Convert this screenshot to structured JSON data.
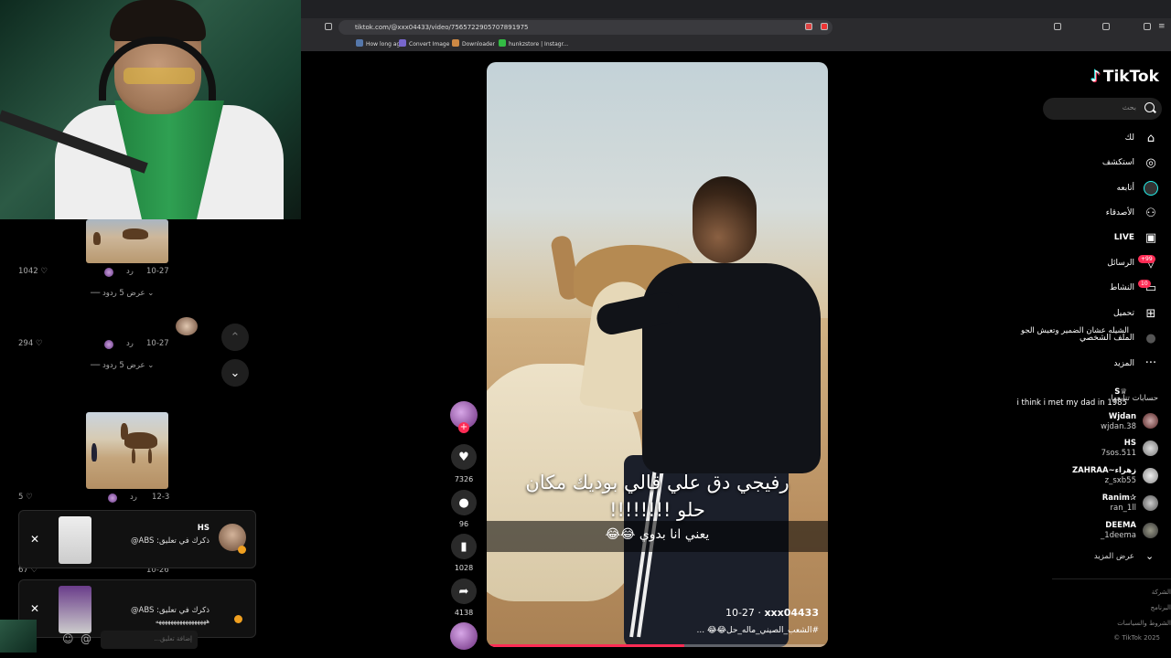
{
  "browser": {
    "url": "tiktok.com/@xxx04433/video/7565722905707891975",
    "bookmarks": [
      "How long ago",
      "Convert Image",
      "Downloader",
      "hunkzstore | Instagr..."
    ]
  },
  "comments": [
    {
      "date": "10-27",
      "reply": "رد",
      "likes": "1042",
      "view_replies": "عرض 5 ردود"
    },
    {
      "text": "الشيله عشان الضمير وتعيش الجو",
      "date": "10-27",
      "reply": "رد",
      "likes": "294",
      "view_replies": "عرض 5 ردود"
    },
    {
      "author": "S",
      "text": "i think i met my dad in 1985",
      "date": "12-3",
      "reply": "رد",
      "likes": "5"
    }
  ],
  "notifications": [
    {
      "title": "HS",
      "subtitle": "ذكرك في تعليق: ABS@"
    },
    {
      "subtitle": "ذكرك في تعليق: ABS@",
      "subtitle2": "هههههههههههههههههه"
    }
  ],
  "hidden_row": {
    "likes": "67",
    "date": "10-26"
  },
  "comment_input_placeholder": "إضافة تعليق...",
  "video": {
    "subtitle_line1": "رفيجي دق علي قالي بوديك مكان",
    "subtitle_line2": "حلو !!!!!!!!",
    "subtitle_line3": "يعني انا بدوي 😂😂",
    "author": "xxx04433",
    "date": "10-27",
    "caption": "#الشعب_الصيني_ماله_حل😂😂 ...",
    "progress": 0.58
  },
  "actions": {
    "likes": "7326",
    "comments": "96",
    "saves": "1028",
    "shares": "4138"
  },
  "sidebar": {
    "logo": "TikTok",
    "search_placeholder": "بحث",
    "nav": [
      {
        "label": "لك",
        "icon": "home-icon"
      },
      {
        "label": "استكشف",
        "icon": "compass-icon"
      },
      {
        "label": "أتابعه",
        "icon": "following-icon"
      },
      {
        "label": "الأصدقاء",
        "icon": "friends-icon"
      },
      {
        "label": "LIVE",
        "icon": "live-icon"
      },
      {
        "label": "الرسائل",
        "icon": "messages-icon",
        "badge": "+99"
      },
      {
        "label": "النشاط",
        "icon": "activity-icon",
        "badge": "10"
      },
      {
        "label": "تحميل",
        "icon": "upload-icon"
      },
      {
        "label": "الملف الشخصي",
        "icon": "profile-icon"
      },
      {
        "label": "المزيد",
        "icon": "more-icon"
      }
    ],
    "following_title": "حسابات تتابعها",
    "following": [
      {
        "name": "Wjdan",
        "user": "wjdan.38"
      },
      {
        "name": "HS",
        "user": "7sos.511"
      },
      {
        "name": "ZAHRAA~زهراء",
        "user": "z_sxb55"
      },
      {
        "name": "Ranim✰",
        "user": "ran_1ll"
      },
      {
        "name": "DEEMA",
        "user": "_1deema"
      }
    ],
    "show_more": "عرض المزيد",
    "footer": [
      "الشركة",
      "البرنامج",
      "الشروط والسياسات",
      "© TikTok 2025"
    ]
  },
  "colors": {
    "accent": "#fe2c55",
    "cyan": "#25f4ee"
  }
}
